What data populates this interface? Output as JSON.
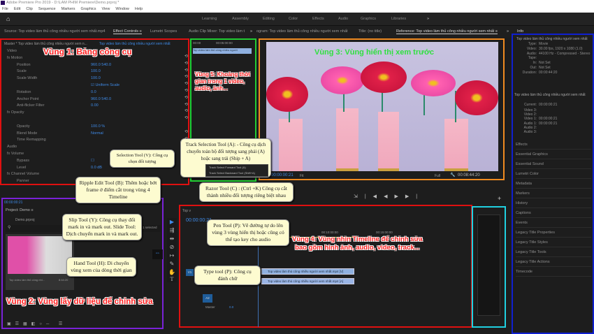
{
  "app": {
    "title": "Adobe Premiere Pro 2019 - D:\\LAM PHIM Premiere\\Demo.prproj *"
  },
  "menu": [
    "File",
    "Edit",
    "Clip",
    "Sequence",
    "Markers",
    "Graphics",
    "View",
    "Window",
    "Help"
  ],
  "workspaces": [
    "Learning",
    "Assembly",
    "Editing",
    "Color",
    "Effects",
    "Audio",
    "Graphics",
    "Libraries",
    "»"
  ],
  "panel_tabs": {
    "source": "Source: Top video làm thủ công nhiều người xem nhất.mp4",
    "effect_controls": "Effect Controls ≡",
    "lumetri": "Lumetri Scopes",
    "audio_mixer": "Audio Clip Mixer: Top video làm t",
    "more1": "»",
    "program": "ogram: Top video làm thủ công nhiều người xem nhất",
    "title": "Title: (no title)",
    "reference": "Reference: Top video làm thủ công nhiều người xem nhất ≡",
    "more2": "»",
    "info": "Info"
  },
  "effect_controls": {
    "master": "Master * Top video làm thủ công nhiều người xem n...",
    "clip": "Top video làm thủ công nhiều người xem nhất",
    "rows": [
      {
        "label": "Video",
        "value": ""
      },
      {
        "label": "fx Motion",
        "value": ""
      },
      {
        "label": "Position",
        "value": "960.0   540.0"
      },
      {
        "label": "Scale",
        "value": "100.0"
      },
      {
        "label": "Scale Width",
        "value": "100.0"
      },
      {
        "label": "",
        "value": "☑ Uniform Scale"
      },
      {
        "label": "Rotation",
        "value": "0.0"
      },
      {
        "label": "Anchor Point",
        "value": "960.0   540.0"
      },
      {
        "label": "Anti-flicker Filter",
        "value": "0.00"
      },
      {
        "label": "fx Opacity",
        "value": ""
      },
      {
        "label": "",
        "value": ""
      },
      {
        "label": "Opacity",
        "value": "100.0 %"
      },
      {
        "label": "Blend Mode",
        "value": "Normal"
      },
      {
        "label": "Time Remapping",
        "value": ""
      },
      {
        "label": "Audio",
        "value": ""
      },
      {
        "label": "fx Volume",
        "value": ""
      },
      {
        "label": "Bypass",
        "value": "☐"
      },
      {
        "label": "Level",
        "value": "0.0 dB"
      },
      {
        "label": "fx Channel Volume",
        "value": ""
      },
      {
        "label": "Panner",
        "value": ""
      }
    ]
  },
  "source_mini": {
    "time_start": "00:00",
    "time_mid": "00:05:00:00",
    "clip": "Top video làm thủ công nhiều người"
  },
  "program": {
    "current": "00:00:00:21",
    "fit": "Fit",
    "full": "Full",
    "duration": "00:08:44:20"
  },
  "project": {
    "timecode": "00:00:00:21",
    "title": "Project: Demo ≡",
    "file": "Demo.prproj",
    "selected": "1 selected",
    "item": "Top video làm thủ công nhi...",
    "item_dur": "8:44:20"
  },
  "timeline": {
    "tab": "Top v",
    "timecode": "00:00:00:21",
    "ruler": [
      "00:05:00:00",
      "00:10:00:00",
      "00:15:00:00"
    ],
    "v1": "V1",
    "a2": "A2",
    "master": "Master",
    "master_val": "0.0",
    "clip_v": "Top video làm thủ công nhiều người xem nhất.mp4 [V]",
    "clip_a": "Top video làm thủ công nhiều người xem nhất.mp4 [A]"
  },
  "info_panel": {
    "clip_name": "Top video làm thủ công nhiều người xem nhất",
    "lines": [
      [
        "Type:",
        "Movie"
      ],
      [
        "Video:",
        "30.00 fps, 1920 x 1080 (1.0)"
      ],
      [
        "Audio:",
        "44100 Hz - Compressed - Stereo"
      ],
      [
        "Tape:",
        ""
      ],
      [
        "In:",
        "Not Set"
      ],
      [
        "Out:",
        "Not Set"
      ],
      [
        "Duration:",
        "00:00:44:20"
      ]
    ],
    "seq_name": "Top video làm thủ công nhiều người xem nhất",
    "seq_lines": [
      [
        "Current:",
        "00:00:00:21"
      ],
      [
        "Video 3:",
        ""
      ],
      [
        "Video 2:",
        ""
      ],
      [
        "Video 1:",
        "00:00:00:21"
      ],
      [
        "Audio 1:",
        "00:00:00:21"
      ],
      [
        "Audio 2:",
        ""
      ],
      [
        "Audio 3:",
        ""
      ]
    ]
  },
  "side_panels": [
    "Effects",
    "Essential Graphics",
    "Essential Sound",
    "Lumetri Color",
    "Metadata",
    "Markers",
    "History",
    "Captions",
    "Events",
    "Legacy Title Properties",
    "Legacy Title Styles",
    "Legacy Title Tools",
    "Legacy Title Actions",
    "Timecode"
  ],
  "regions": {
    "r1": "Vùng 1: Bảng công cụ",
    "r2": "Vùng 2: Vùng lấy dữ liệu để chỉnh sửa",
    "r3": "Vùng 3: Vùng hiển thị xem trước",
    "r4a": "Vùng 4: Vùng nhìn Timeline để chỉnh sửa",
    "r4b": "bao gồm hình ảnh, audio, video, track...",
    "r5": "Vùng 5: Khoảng thời gian trong 1 video, audio, ảnh..."
  },
  "callouts": {
    "selection": "Selection Tool (V): Công cụ chọn đối tượng",
    "track": "Track Selection Tool (A): - Công cụ dịch chuyển toàn bộ đối tượng sang phải (A) hoặc sang trái (Ship + A)",
    "ripple": "Ripple Edit Tool (B): Thêm hoặc bớt frame ở điểm cắt trong vùng 4 Timeline",
    "razor": "Razor Tool (C) : (Ctrl +K) Công cụ cắt thành nhiều đối tượng riêng biệt nhau",
    "slip": "Slip Tool (Y): Công cụ thay đổi mark in và mark out. Slide Tool: Dịch chuyển mark in và mark out.",
    "pen": "Pen Tool (P): Vẽ đường tự do lên vùng 3 vùng hiển thị hoặc cũng có thể tạo key cho audio",
    "hand": "Hand Tool (H): Di chuyển vùng xem của dòng thời gian",
    "type": "Type tool (P): Công cụ đánh chữ"
  },
  "tooltip_menu": [
    "Track Select Forward Tool (A)",
    "Track Select Backward Tool (Shift+A)"
  ],
  "colors": {
    "region1": "#e01010",
    "region2": "#7a22d8",
    "region3": "#f08a20",
    "region4": "#e01010",
    "region5": "#22cc33",
    "info": "#1020d0",
    "meter": "#20d0e0",
    "accent": "#3f8be8"
  }
}
